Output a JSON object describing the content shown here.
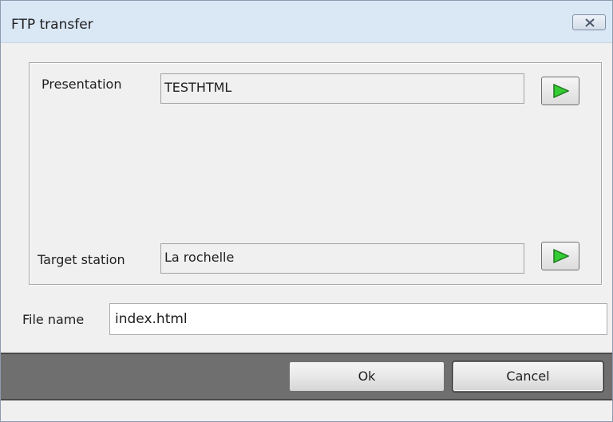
{
  "window": {
    "title": "FTP transfer"
  },
  "presentation": {
    "label": "Presentation",
    "value": "TESTHTML"
  },
  "target_station": {
    "label": "Target station",
    "value": "La rochelle"
  },
  "file_name": {
    "label": "File name",
    "value": "index.html"
  },
  "buttons": {
    "ok": "Ok",
    "cancel": "Cancel"
  },
  "colors": {
    "play_arrow": "#33cc33",
    "titlebar": "#dae7f5",
    "footer_bar": "#6f6f6f"
  },
  "icons": {
    "close": "close-icon",
    "play": "play-arrow-icon"
  }
}
